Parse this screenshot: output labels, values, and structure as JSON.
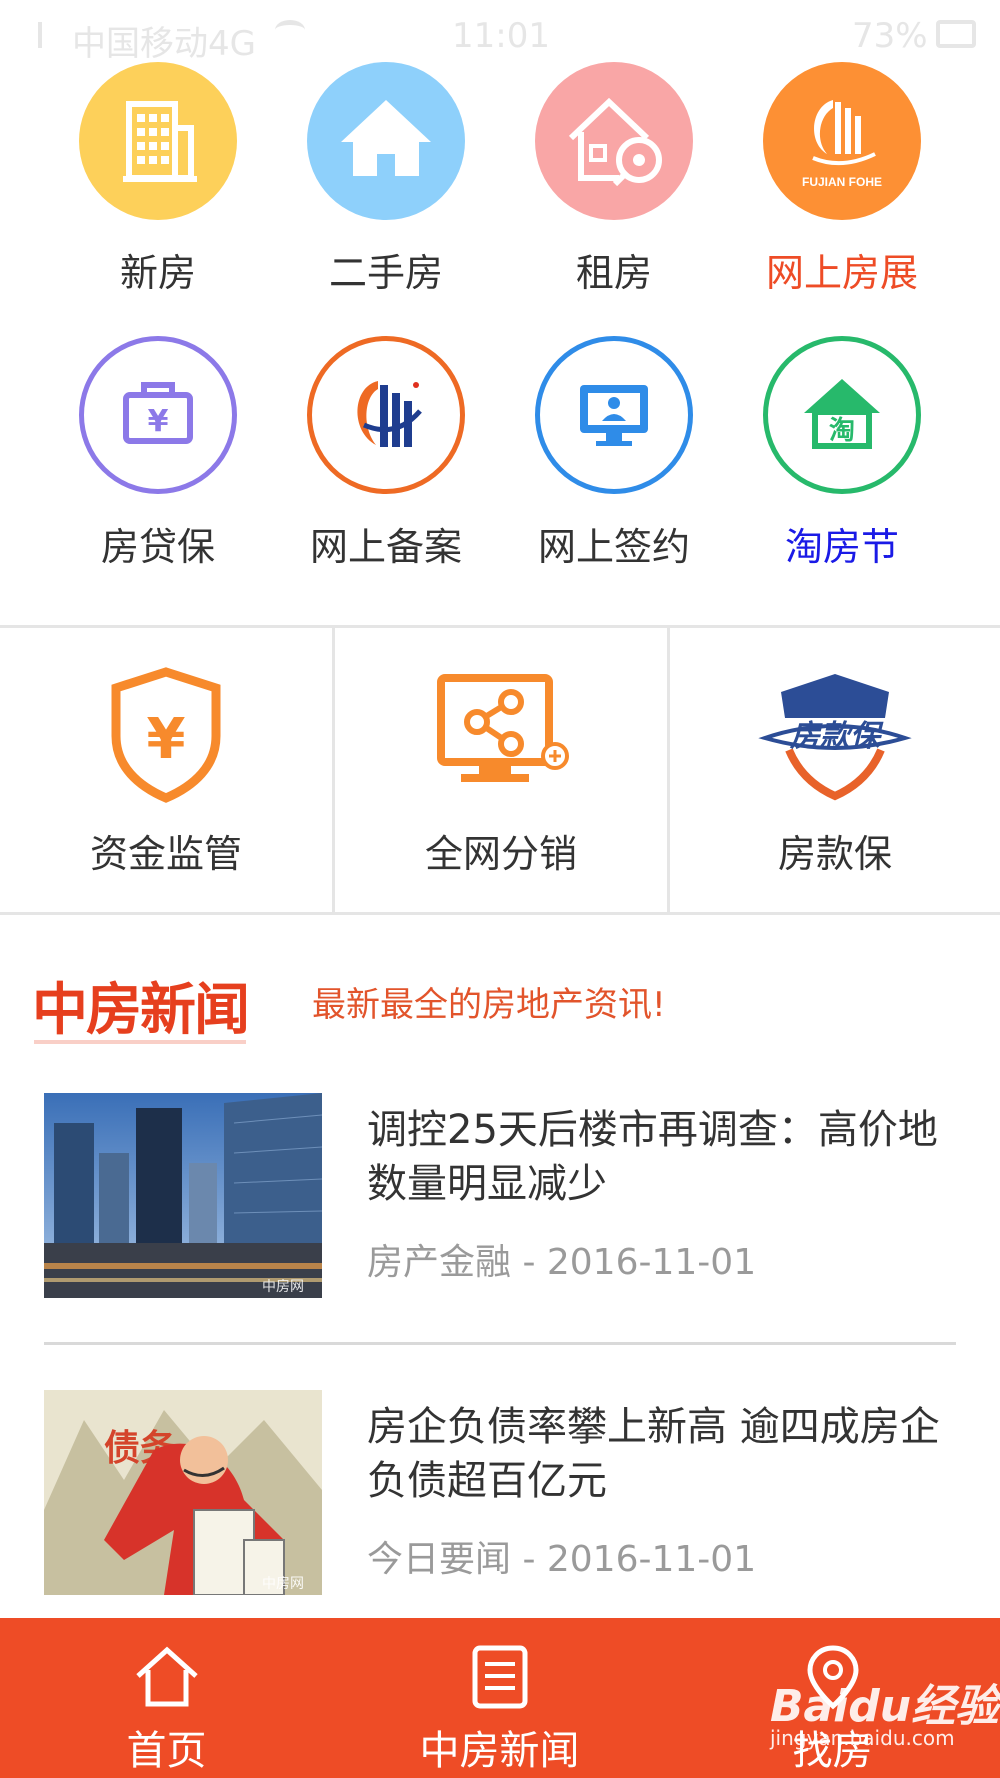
{
  "status_bar": {
    "carrier": "中国移动4G",
    "time": "11:01",
    "battery": "73%"
  },
  "grid_menu": [
    {
      "label": "新房",
      "icon": "building-icon",
      "color": "#fdd05a",
      "label_color": "#333333"
    },
    {
      "label": "二手房",
      "icon": "house-icon",
      "color": "#8ed0fb",
      "label_color": "#333333"
    },
    {
      "label": "租房",
      "icon": "house-key-icon",
      "color": "#f9a6a6",
      "label_color": "#333333"
    },
    {
      "label": "网上房展",
      "icon": "fujian-fohe-logo-icon",
      "logo_text": "FUJIAN FOHE",
      "color": "#fd9034",
      "label_color": "#ee4c26"
    },
    {
      "label": "房贷保",
      "icon": "money-bag-icon",
      "color": "#8c79e8",
      "label_color": "#333333"
    },
    {
      "label": "网上备案",
      "icon": "record-logo-icon",
      "color": "#ee6a24",
      "label_color": "#333333"
    },
    {
      "label": "网上签约",
      "icon": "monitor-person-icon",
      "color": "#2f8ce8",
      "label_color": "#333333"
    },
    {
      "label": "淘房节",
      "icon": "tao-house-icon",
      "icon_text": "淘",
      "color": "#27b96b",
      "label_color": "#1a1ae6"
    }
  ],
  "features": [
    {
      "label": "资金监管",
      "icon": "shield-yuan-icon"
    },
    {
      "label": "全网分销",
      "icon": "network-monitor-icon"
    },
    {
      "label": "房款保",
      "icon": "fangkuanbao-badge-icon",
      "icon_text": "房款保"
    }
  ],
  "news_section": {
    "logo": "中房新闻",
    "tagline": "最新最全的房地产资讯!",
    "items": [
      {
        "title": "调控25天后楼市再调查：高价地数量明显减少",
        "meta": "房产金融 - 2016-11-01",
        "thumb_watermark": "中房网"
      },
      {
        "title": "房企负债率攀上新高 逾四成房企负债超百亿元",
        "meta": "今日要闻 - 2016-11-01",
        "thumb_text": "债务",
        "thumb_watermark": "中房网"
      }
    ]
  },
  "bottom_nav": [
    {
      "label": "首页",
      "icon": "home-icon"
    },
    {
      "label": "中房新闻",
      "icon": "news-icon"
    },
    {
      "label": "找房",
      "icon": "location-icon"
    }
  ],
  "watermark": {
    "text": "Baidu经验",
    "sub": "jingyan.baidu.com"
  }
}
